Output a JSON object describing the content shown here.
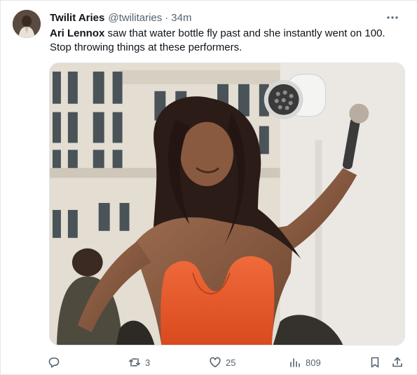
{
  "tweet": {
    "author": {
      "display_name": "Twilit Aries",
      "handle": "@twilitaries",
      "separator": "·",
      "time": "34m"
    },
    "text": {
      "mention": "Ari Lennox",
      "body_line1": " saw that water bottle fly past and she instantly went on 100.",
      "body_line2": "Stop throwing things at these performers."
    },
    "media": {
      "type": "photo"
    },
    "actions": {
      "reply_icon": "reply-icon",
      "retweet_count": "3",
      "like_count": "25",
      "views_count": "809",
      "bookmark_icon": "bookmark-icon",
      "share_icon": "share-icon"
    }
  },
  "colors": {
    "text": "#0f1419",
    "secondary": "#536471",
    "dress": "#e8562a",
    "background": "#ffffff"
  }
}
